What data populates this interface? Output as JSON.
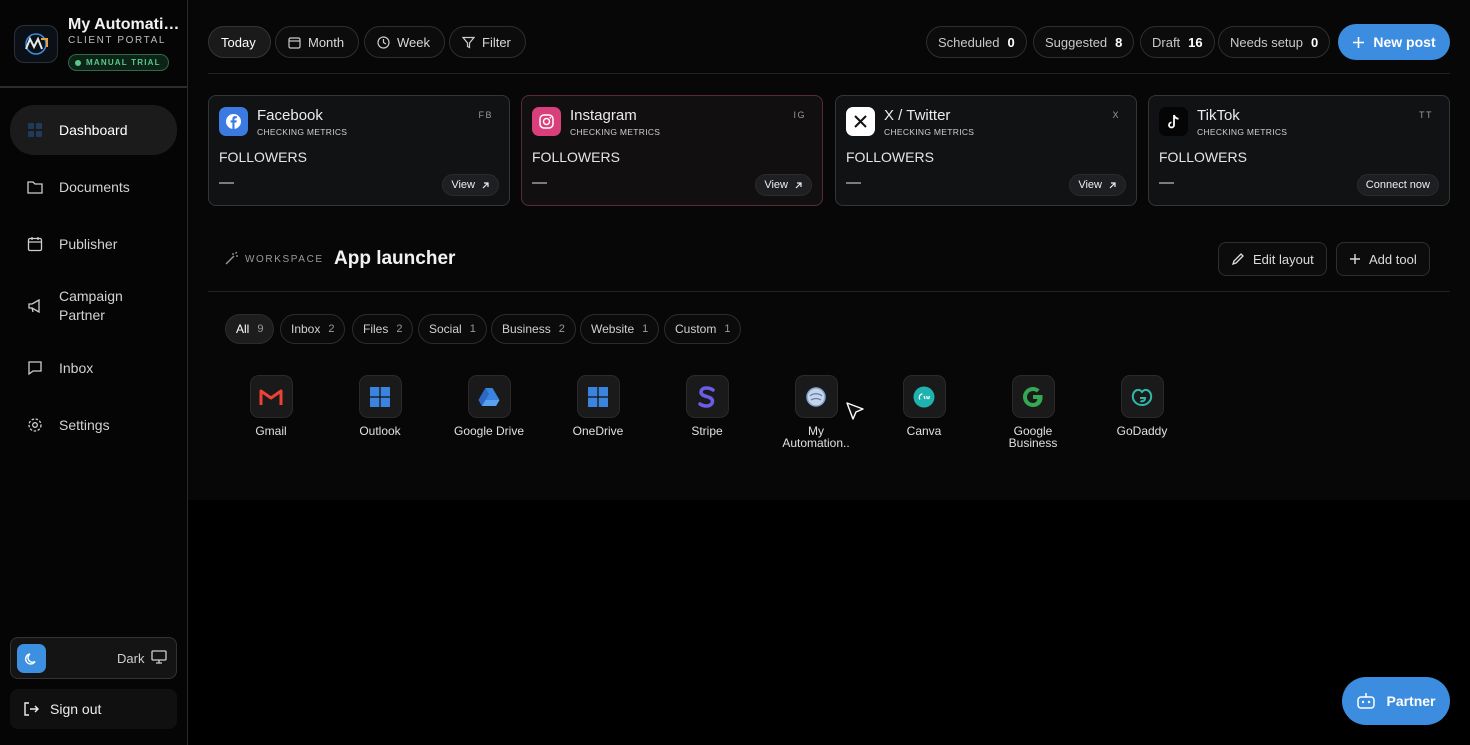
{
  "brand": {
    "name": "My Automation Partner",
    "subtitle": "CLIENT PORTAL",
    "badge": "MANUAL TRIAL"
  },
  "sidebar": {
    "items": [
      {
        "label": "Dashboard",
        "icon": "dashboard-icon"
      },
      {
        "label": "Documents",
        "icon": "folder-icon"
      },
      {
        "label": "Publisher",
        "icon": "calendar-icon"
      },
      {
        "label": "Campaign Partner",
        "icon": "megaphone-icon"
      },
      {
        "label": "Inbox",
        "icon": "message-icon"
      },
      {
        "label": "Settings",
        "icon": "gear-icon"
      }
    ],
    "theme_label": "Dark",
    "sign_out": "Sign out"
  },
  "topbar": {
    "today": "Today",
    "month": "Month",
    "week": "Week",
    "filter": "Filter",
    "stats": [
      {
        "label": "Scheduled",
        "value": "0"
      },
      {
        "label": "Suggested",
        "value": "8"
      },
      {
        "label": "Draft",
        "value": "16"
      },
      {
        "label": "Needs setup",
        "value": "0"
      }
    ],
    "new_post": "New post"
  },
  "cards": [
    {
      "name": "Facebook",
      "code": "FB",
      "status": "CHECKING METRICS",
      "metric": "FOLLOWERS",
      "value": "—",
      "action": "View",
      "color": "#1877f2"
    },
    {
      "name": "Instagram",
      "code": "IG",
      "status": "CHECKING METRICS",
      "metric": "FOLLOWERS",
      "value": "—",
      "action": "View",
      "color": "#e1306c"
    },
    {
      "name": "X / Twitter",
      "code": "X",
      "status": "CHECKING METRICS",
      "metric": "FOLLOWERS",
      "value": "—",
      "action": "View",
      "color": "#ffffff"
    },
    {
      "name": "TikTok",
      "code": "TT",
      "status": "CHECKING METRICS",
      "metric": "FOLLOWERS",
      "value": "—",
      "action": "Connect now",
      "color": "#000000"
    }
  ],
  "workspace": {
    "label": "WORKSPACE",
    "title": "App launcher",
    "edit_layout": "Edit layout",
    "add_tool": "Add tool"
  },
  "filters": [
    {
      "label": "All",
      "count": "9"
    },
    {
      "label": "Inbox",
      "count": "2"
    },
    {
      "label": "Files",
      "count": "2"
    },
    {
      "label": "Social",
      "count": "1"
    },
    {
      "label": "Business",
      "count": "2"
    },
    {
      "label": "Website",
      "count": "1"
    },
    {
      "label": "Custom",
      "count": "1"
    }
  ],
  "apps": [
    {
      "label": "Gmail",
      "icon": "gmail-icon"
    },
    {
      "label": "Outlook",
      "icon": "outlook-icon"
    },
    {
      "label": "Google Drive",
      "icon": "google-drive-icon"
    },
    {
      "label": "OneDrive",
      "icon": "onedrive-icon"
    },
    {
      "label": "Stripe",
      "icon": "stripe-icon"
    },
    {
      "label": "My Automation..",
      "icon": "my-automation-icon"
    },
    {
      "label": "Canva",
      "icon": "canva-icon"
    },
    {
      "label": "Google Business",
      "icon": "google-business-icon"
    },
    {
      "label": "GoDaddy",
      "icon": "godaddy-icon"
    }
  ],
  "partner_button": "Partner",
  "colors": {
    "accent": "#3c8de0",
    "trial": "#59c98a"
  }
}
